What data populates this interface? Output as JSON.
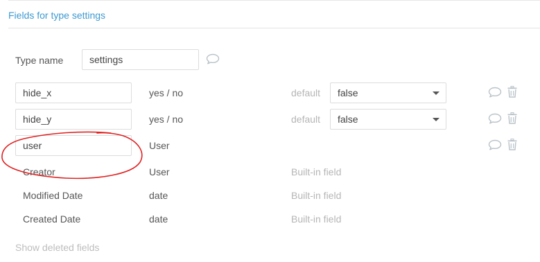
{
  "section": {
    "title": "Fields for type settings"
  },
  "type_name": {
    "label": "Type name",
    "value": "settings"
  },
  "fields": [
    {
      "name": "hide_x",
      "type": "yes / no",
      "default_label": "default",
      "default_value": "false"
    },
    {
      "name": "hide_y",
      "type": "yes / no",
      "default_label": "default",
      "default_value": "false"
    },
    {
      "name": "user",
      "type": "User"
    }
  ],
  "builtin_fields": [
    {
      "name": "Creator",
      "type": "User",
      "note": "Built-in field"
    },
    {
      "name": "Modified Date",
      "type": "date",
      "note": "Built-in field"
    },
    {
      "name": "Created Date",
      "type": "date",
      "note": "Built-in field"
    }
  ],
  "footer": {
    "show_deleted": "Show deleted fields"
  },
  "icons": {
    "comment": "comment-icon",
    "delete": "trash-icon"
  },
  "colors": {
    "accent": "#3d9ad1",
    "annotation": "#e02020",
    "muted": "#b5b5b5"
  }
}
